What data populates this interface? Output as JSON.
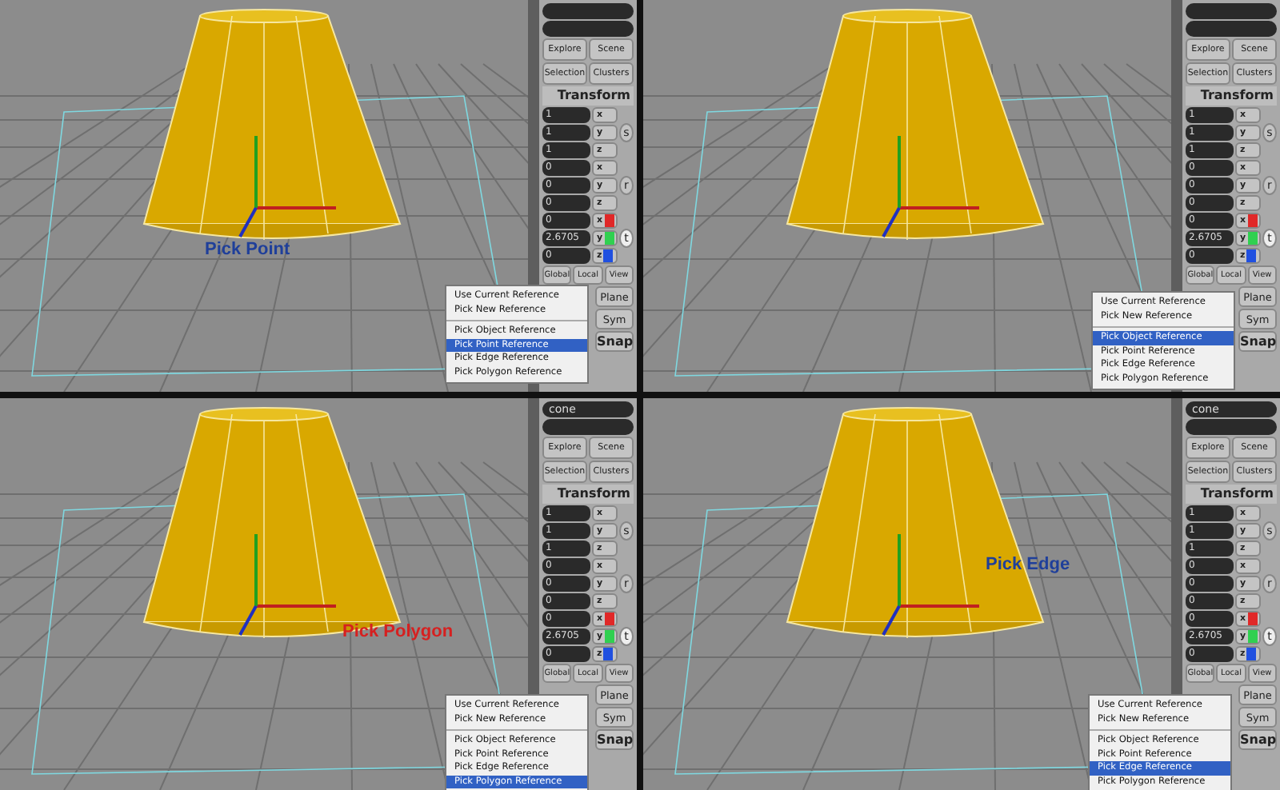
{
  "views": [
    {
      "label": {
        "text": "Pick Point",
        "color": "#1f3f9a"
      },
      "panel": {
        "buttons": [
          "Explore",
          "Scene",
          "Selection",
          "Clusters"
        ],
        "section": "Transform",
        "groups": [
          {
            "mode": "s",
            "values": [
              "1",
              "1",
              "1"
            ],
            "axes": [
              "x",
              "y",
              "z"
            ]
          },
          {
            "mode": "r",
            "values": [
              "0",
              "0",
              "0"
            ],
            "axes": [
              "x",
              "y",
              "z"
            ]
          },
          {
            "mode": "t",
            "values": [
              "0",
              "2.6705",
              "0"
            ],
            "axes": [
              "x",
              "y",
              "z"
            ]
          }
        ],
        "spaces": [
          "Global",
          "Local",
          "View"
        ],
        "tools": [
          "Plane",
          "Sym",
          "Snap"
        ]
      },
      "menu": [
        {
          "text": "Use Current Reference",
          "selected": false
        },
        {
          "text": "Pick New Reference",
          "selected": false
        },
        {
          "kind": "separator"
        },
        {
          "text": "Pick Object Reference",
          "selected": false
        },
        {
          "text": "Pick Point Reference",
          "selected": true
        },
        {
          "text": "Pick Edge Reference",
          "selected": false
        },
        {
          "text": "Pick Polygon Reference",
          "selected": false
        }
      ]
    },
    {
      "panel": {
        "buttons": [
          "Explore",
          "Scene",
          "Selection",
          "Clusters"
        ],
        "section": "Transform",
        "groups": [
          {
            "mode": "s",
            "values": [
              "1",
              "1",
              "1"
            ],
            "axes": [
              "x",
              "y",
              "z"
            ]
          },
          {
            "mode": "r",
            "values": [
              "0",
              "0",
              "0"
            ],
            "axes": [
              "x",
              "y",
              "z"
            ]
          },
          {
            "mode": "t",
            "values": [
              "0",
              "2.6705",
              "0"
            ],
            "axes": [
              "x",
              "y",
              "z"
            ]
          }
        ],
        "spaces": [
          "Global",
          "Local",
          "View"
        ],
        "tools": [
          "Plane",
          "Sym",
          "Snap"
        ]
      },
      "menu": [
        {
          "text": "Use Current Reference",
          "selected": false
        },
        {
          "text": "Pick New Reference",
          "selected": false
        },
        {
          "kind": "separator"
        },
        {
          "text": "Pick Object Reference",
          "selected": true
        },
        {
          "text": "Pick Point Reference",
          "selected": false
        },
        {
          "text": "Pick Edge Reference",
          "selected": false
        },
        {
          "text": "Pick Polygon Reference",
          "selected": false
        }
      ]
    },
    {
      "name": "cone",
      "label": {
        "text": "Pick Polygon",
        "color": "#d62020"
      },
      "panel": {
        "buttons": [
          "Explore",
          "Scene",
          "Selection",
          "Clusters"
        ],
        "section": "Transform",
        "groups": [
          {
            "mode": "s",
            "values": [
              "1",
              "1",
              "1"
            ],
            "axes": [
              "x",
              "y",
              "z"
            ]
          },
          {
            "mode": "r",
            "values": [
              "0",
              "0",
              "0"
            ],
            "axes": [
              "x",
              "y",
              "z"
            ]
          },
          {
            "mode": "t",
            "values": [
              "0",
              "2.6705",
              "0"
            ],
            "axes": [
              "x",
              "y",
              "z"
            ]
          }
        ],
        "spaces": [
          "Global",
          "Local",
          "View"
        ],
        "tools": [
          "Plane",
          "Sym",
          "Snap"
        ]
      },
      "menu": [
        {
          "text": "Use Current Reference",
          "selected": false
        },
        {
          "text": "Pick New Reference",
          "selected": false
        },
        {
          "kind": "separator"
        },
        {
          "text": "Pick Object Reference",
          "selected": false
        },
        {
          "text": "Pick Point Reference",
          "selected": false
        },
        {
          "text": "Pick Edge Reference",
          "selected": false
        },
        {
          "text": "Pick Polygon Reference",
          "selected": true
        }
      ]
    },
    {
      "name": "cone",
      "label": {
        "text": "Pick Edge",
        "color": "#1f3f9a"
      },
      "panel": {
        "buttons": [
          "Explore",
          "Scene",
          "Selection",
          "Clusters"
        ],
        "section": "Transform",
        "groups": [
          {
            "mode": "s",
            "values": [
              "1",
              "1",
              "1"
            ],
            "axes": [
              "x",
              "y",
              "z"
            ]
          },
          {
            "mode": "r",
            "values": [
              "0",
              "0",
              "0"
            ],
            "axes": [
              "x",
              "y",
              "z"
            ]
          },
          {
            "mode": "t",
            "values": [
              "0",
              "2.6705",
              "0"
            ],
            "axes": [
              "x",
              "y",
              "z"
            ]
          }
        ],
        "spaces": [
          "Global",
          "Local",
          "View"
        ],
        "tools": [
          "Plane",
          "Sym",
          "Snap"
        ]
      },
      "menu": [
        {
          "text": "Use Current Reference",
          "selected": false
        },
        {
          "text": "Pick New Reference",
          "selected": false
        },
        {
          "kind": "separator"
        },
        {
          "text": "Pick Object Reference",
          "selected": false
        },
        {
          "text": "Pick Point Reference",
          "selected": false
        },
        {
          "text": "Pick Edge Reference",
          "selected": true
        },
        {
          "text": "Pick Polygon Reference",
          "selected": false
        }
      ]
    }
  ]
}
